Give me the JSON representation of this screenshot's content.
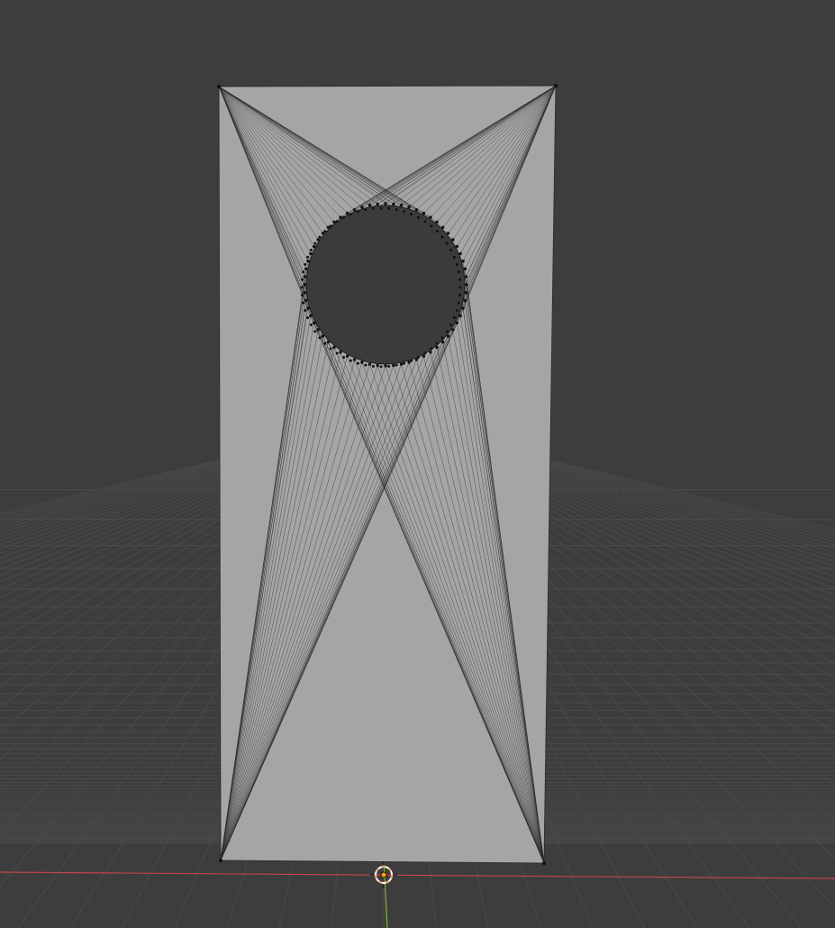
{
  "viewport": {
    "background_color": "#3d3d3d",
    "grid_line_color": "#4a4a4a",
    "x_axis_color": "#c0444a",
    "y_axis_color": "#7fb234",
    "mesh_face_color": "#a3a5a6",
    "mesh_wire_color": "#2b2b2b",
    "hole_color": "#3b3b3b",
    "vertex_color": "#111111",
    "cursor_primary_color": "#e9a07a",
    "cursor_secondary_color": "#ffffff",
    "origin_dot_color": "#f0a020"
  },
  "mesh": {
    "object": "plane-with-circular-hole",
    "ring_vertex_count": 64,
    "fan_corner_count": 4
  },
  "icons": {
    "cursor": "3d-cursor-icon",
    "origin": "object-origin-icon"
  }
}
